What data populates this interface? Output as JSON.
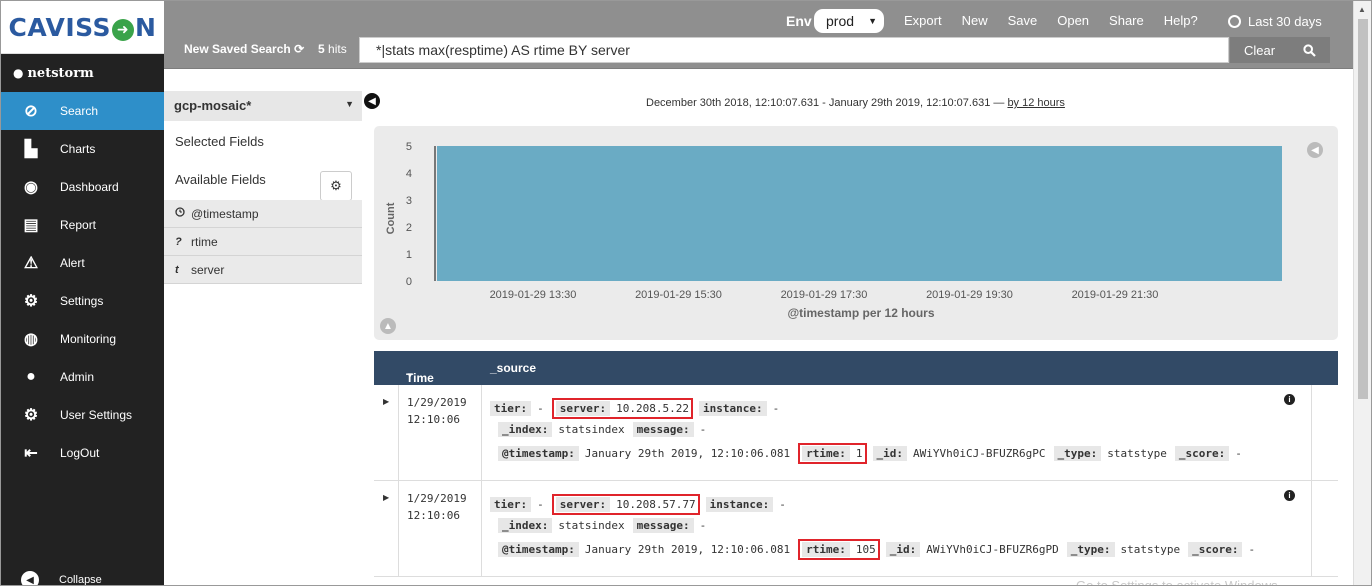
{
  "app": {
    "logo_text": "CAVISS",
    "logo_text_end": "N",
    "user": "netstorm"
  },
  "sidebar": {
    "items": [
      {
        "label": "Search",
        "icon": "compass-icon",
        "active": true
      },
      {
        "label": "Charts",
        "icon": "bar-chart-icon",
        "active": false
      },
      {
        "label": "Dashboard",
        "icon": "dashboard-icon",
        "active": false
      },
      {
        "label": "Report",
        "icon": "report-icon",
        "active": false
      },
      {
        "label": "Alert",
        "icon": "alert-icon",
        "active": false
      },
      {
        "label": "Settings",
        "icon": "gear-icon",
        "active": false
      },
      {
        "label": "Monitoring",
        "icon": "globe-icon",
        "active": false
      },
      {
        "label": "Admin",
        "icon": "user-icon",
        "active": false
      },
      {
        "label": "User Settings",
        "icon": "user-gear-icon",
        "active": false
      },
      {
        "label": "LogOut",
        "icon": "logout-icon",
        "active": false
      }
    ],
    "collapse": "Collapse"
  },
  "topbar": {
    "env_label": "Env",
    "env_value": "prod",
    "menu": [
      "Export",
      "New",
      "Save",
      "Open",
      "Share",
      "Help?"
    ],
    "range": "Last 30 days",
    "saved_search": "New Saved Search",
    "hits_count": "5",
    "hits_label": "hits",
    "query": "*|stats max(resptime) AS rtime BY server",
    "clear": "Clear"
  },
  "fields": {
    "index": "gcp-mosaic*",
    "selected_title": "Selected Fields",
    "available_title": "Available Fields",
    "items": [
      {
        "type": "clock",
        "name": "@timestamp"
      },
      {
        "type": "?",
        "name": "rtime"
      },
      {
        "type": "t",
        "name": "server"
      }
    ]
  },
  "main": {
    "time_range": "December 30th 2018, 12:10:07.631 - January 29th 2019, 12:10:07.631 —",
    "interval": "by 12 hours"
  },
  "chart_data": {
    "type": "bar",
    "title": "",
    "xlabel": "@timestamp per 12 hours",
    "ylabel": "Count",
    "ylim": [
      0,
      5
    ],
    "yticks": [
      0,
      1,
      2,
      3,
      4,
      5
    ],
    "xticks": [
      "2019-01-29 13:30",
      "2019-01-29 15:30",
      "2019-01-29 17:30",
      "2019-01-29 19:30",
      "2019-01-29 21:30"
    ],
    "categories": [
      "2019-01-29 12:00"
    ],
    "values": [
      5
    ],
    "colors": {
      "bar": "#6aabc4"
    }
  },
  "table": {
    "headers": {
      "time": "Time",
      "source": "_source"
    },
    "rows": [
      {
        "date": "1/29/2019",
        "time": "12:10:06",
        "tier_k": "tier:",
        "tier_v": "-",
        "server_k": "server:",
        "server_v": "10.208.5.22",
        "instance_k": "instance:",
        "instance_v": "-",
        "index_k": "_index:",
        "index_v": "statsindex",
        "message_k": "message:",
        "message_v": "-",
        "ts_k": "@timestamp:",
        "ts_v": "January 29th 2019, 12:10:06.081",
        "rtime_k": "rtime:",
        "rtime_v": "1",
        "id_k": "_id:",
        "id_v": "AWiYVh0iCJ-BFUZR6gPC",
        "type_k": "_type:",
        "type_v": "statstype",
        "score_k": "_score:",
        "score_v": "-"
      },
      {
        "date": "1/29/2019",
        "time": "12:10:06",
        "tier_k": "tier:",
        "tier_v": "-",
        "server_k": "server:",
        "server_v": "10.208.57.77",
        "instance_k": "instance:",
        "instance_v": "-",
        "index_k": "_index:",
        "index_v": "statsindex",
        "message_k": "message:",
        "message_v": "-",
        "ts_k": "@timestamp:",
        "ts_v": "January 29th 2019, 12:10:06.081",
        "rtime_k": "rtime:",
        "rtime_v": "105",
        "id_k": "_id:",
        "id_v": "AWiYVh0iCJ-BFUZR6gPD",
        "type_k": "_type:",
        "type_v": "statstype",
        "score_k": "_score:",
        "score_v": "-"
      }
    ]
  },
  "watermark": "Go to Settings to activate Windows."
}
